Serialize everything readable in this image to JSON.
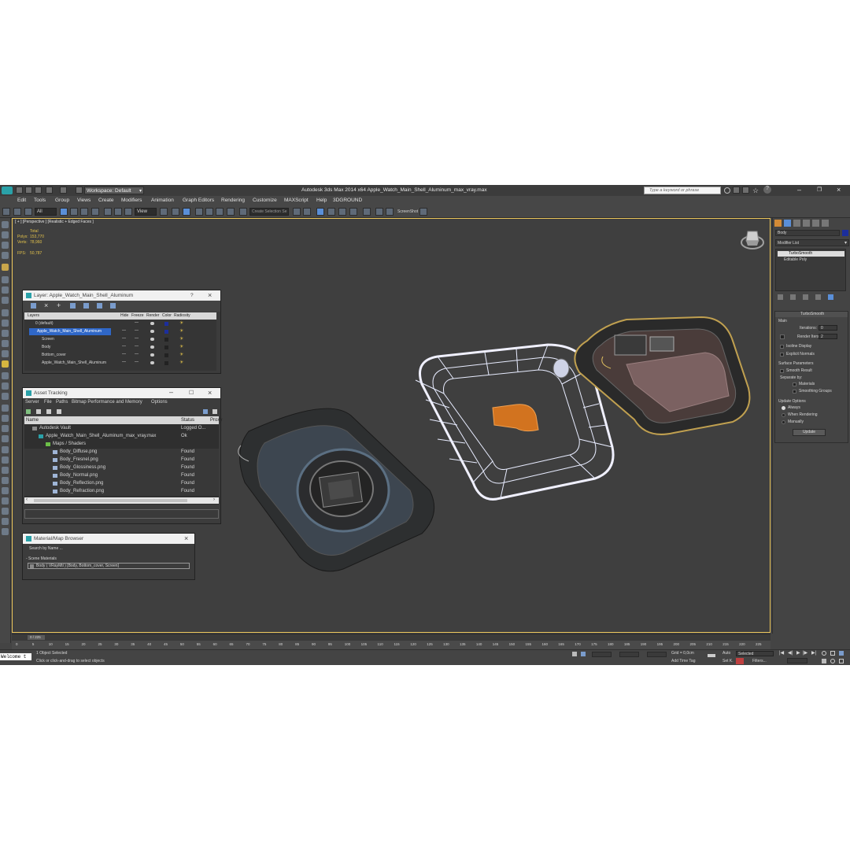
{
  "app": {
    "title": "Autodesk 3ds Max  2014 x64     Apple_Watch_Main_Shell_Aluminum_max_vray.max",
    "workspace": "Workspace: Default",
    "search_placeholder": "Type a keyword or phrase"
  },
  "menu": [
    "Edit",
    "Tools",
    "Group",
    "Views",
    "Create",
    "Modifiers",
    "Animation",
    "Graph Editors",
    "Rendering",
    "Customize",
    "MAXScript",
    "Help",
    "3DGROUND"
  ],
  "toolbar": {
    "selection_filter": "All",
    "reference_coord": "View",
    "named_selection": "Create Selection Se",
    "screenshot_label": "ScreenShot"
  },
  "viewport": {
    "label": "[ + ] [Perspective ] [Realistic + Edged Faces ]",
    "stats": {
      "total_label": "Total",
      "polys_label": "Polys:",
      "polys_value": "153,770",
      "verts_label": "Verts:",
      "verts_value": "78,960",
      "fps_label": "FPS:",
      "fps_value": "50,787"
    }
  },
  "layer_window": {
    "title": "Layer: Apple_Watch_Main_Shell_Aluminum",
    "columns": [
      "Layers",
      "Hide",
      "Freeze",
      "Render",
      "Color",
      "Radiosity"
    ],
    "rows": [
      {
        "name": "0 (default)",
        "hide": "",
        "freeze": "—",
        "render": "",
        "color": "#1c2e9c"
      },
      {
        "name": "Apple_Watch_Main_Shell_Aluminum",
        "hide": "—",
        "freeze": "—",
        "render": "",
        "color": "#1c2e9c"
      },
      {
        "name": "Screen",
        "hide": "—",
        "freeze": "—",
        "render": "",
        "color": "#222222"
      },
      {
        "name": "Body",
        "hide": "—",
        "freeze": "—",
        "render": "",
        "color": "#222222"
      },
      {
        "name": "Bottom_cover",
        "hide": "—",
        "freeze": "—",
        "render": "",
        "color": "#222222"
      },
      {
        "name": "Apple_Watch_Main_Shell_Aluminum",
        "hide": "—",
        "freeze": "—",
        "render": "",
        "color": "#222222"
      }
    ]
  },
  "asset_window": {
    "title": "Asset Tracking",
    "menu": [
      "Server",
      "File",
      "Paths",
      "Bitmap Performance and Memory",
      "Options"
    ],
    "columns": [
      "Name",
      "Status",
      "Proxy"
    ],
    "rows": [
      {
        "name": "Autodesk Vault",
        "status": "Logged O..."
      },
      {
        "name": "Apple_Watch_Main_Shell_Aluminum_max_vray.max",
        "status": "Ok"
      },
      {
        "name": "Maps / Shaders",
        "status": ""
      },
      {
        "name": "Body_Diffuse.png",
        "status": "Found"
      },
      {
        "name": "Body_Fresnel.png",
        "status": "Found"
      },
      {
        "name": "Body_Glossiness.png",
        "status": "Found"
      },
      {
        "name": "Body_Normal.png",
        "status": "Found"
      },
      {
        "name": "Body_Reflection.png",
        "status": "Found"
      },
      {
        "name": "Body_Refraction.png",
        "status": "Found"
      }
    ]
  },
  "material_window": {
    "title": "Material/Map Browser",
    "search_placeholder": "Search by Name ...",
    "section": "- Scene Materials",
    "item": "Body  ( VRayMtl )  [Body, Bottom_cover, Screen]"
  },
  "command_panel": {
    "object_name": "Body",
    "modifier_list": "Modifier List",
    "stack": [
      "TurboSmooth",
      "Editable Poly"
    ],
    "rollout_title": "TurboSmooth",
    "main_label": "Main",
    "iterations_label": "Iterations:",
    "iterations_value": "0",
    "render_iters_label": "Render Iters:",
    "render_iters_value": "2",
    "isoline": "Isoline Display",
    "explicit": "Explicit Normals",
    "surface_params": "Surface Parameters",
    "smooth_result": "Smooth Result",
    "separate_by": "Separate by:",
    "materials": "Materials",
    "smoothing_groups": "Smoothing Groups",
    "update_options": "Update Options",
    "always": "Always",
    "when_rendering": "When Rendering",
    "manually": "Manually",
    "update": "Update"
  },
  "timeline": {
    "frame": "0 / 225",
    "ticks": [
      "0",
      "5",
      "10",
      "15",
      "20",
      "25",
      "30",
      "35",
      "40",
      "45",
      "50",
      "55",
      "60",
      "65",
      "70",
      "75",
      "80",
      "85",
      "90",
      "95",
      "100",
      "105",
      "110",
      "115",
      "120",
      "125",
      "130",
      "135",
      "140",
      "145",
      "150",
      "155",
      "160",
      "165",
      "170",
      "175",
      "180",
      "185",
      "190",
      "195",
      "200",
      "205",
      "210",
      "215",
      "220",
      "225"
    ]
  },
  "status": {
    "welcome": "Welcome t",
    "selected": "1 Object Selected",
    "prompt": "Click or click-and-drag to select objects",
    "grid": "Grid = 0,0cm",
    "add_time_tag": "Add Time Tag",
    "auto": "Auto",
    "selected_dropdown": "Selected",
    "set_k": "Set K.",
    "filters": "Filters..."
  }
}
